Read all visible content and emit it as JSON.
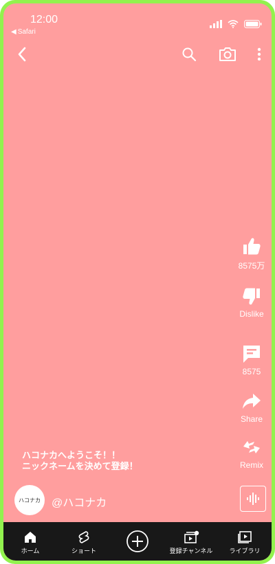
{
  "status_bar": {
    "time": "12:00",
    "back_app": "Safari",
    "icons": [
      "signal-icon",
      "wifi-icon",
      "battery-icon"
    ]
  },
  "top_bar": {
    "icons": [
      "back-icon",
      "search-icon",
      "camera-icon",
      "more-icon"
    ]
  },
  "actions": {
    "like_count": "8575万",
    "dislike_label": "Dislike",
    "comment_count": "8575",
    "share_label": "Share",
    "remix_label": "Remix"
  },
  "caption": {
    "line1": "ハコナカへようこそ！！",
    "line2": "ニックネームを決めて登録！"
  },
  "channel": {
    "avatar_text": "ハコナカ",
    "handle": "@ハコナカ"
  },
  "bottom_nav": {
    "home": "ホーム",
    "shorts": "ショート",
    "subscriptions": "登録チャンネル",
    "library": "ライブラリ"
  },
  "colors": {
    "frame": "#92f24e",
    "background": "#ff9e9e",
    "nav_bar": "#181818"
  }
}
